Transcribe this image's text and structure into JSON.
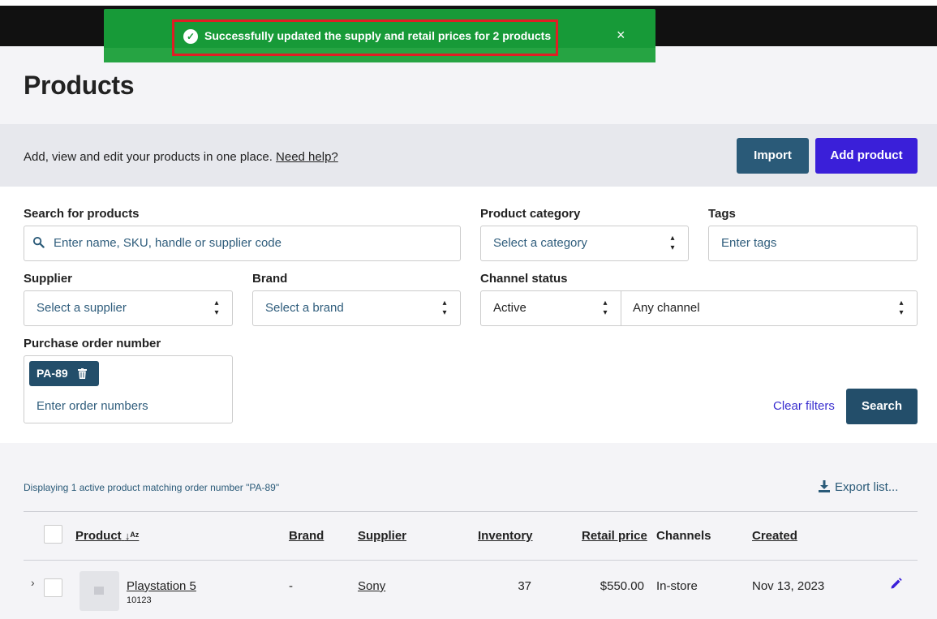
{
  "toast": {
    "message": "Successfully updated the supply and retail prices for 2 products",
    "close_glyph": "×",
    "check_glyph": "✓",
    "color": "#179a38"
  },
  "header": {
    "title": "Products"
  },
  "intro": {
    "text": "Add, view and edit your products in one place. ",
    "help_link": "Need help?",
    "import_label": "Import",
    "add_product_label": "Add product"
  },
  "filters": {
    "search": {
      "label": "Search for products",
      "placeholder": "Enter name, SKU, handle or supplier code",
      "icon": "search-icon"
    },
    "category": {
      "label": "Product category",
      "placeholder": "Select a category"
    },
    "tags": {
      "label": "Tags",
      "placeholder": "Enter tags"
    },
    "supplier": {
      "label": "Supplier",
      "placeholder": "Select a supplier"
    },
    "brand": {
      "label": "Brand",
      "placeholder": "Select a brand"
    },
    "channel_status": {
      "label": "Channel status",
      "status_value": "Active",
      "channel_value": "Any channel"
    },
    "purchase_order": {
      "label": "Purchase order number",
      "chip": "PA-89",
      "placeholder": "Enter order numbers"
    },
    "clear_label": "Clear filters",
    "search_label": "Search"
  },
  "results": {
    "message": "Displaying 1 active product matching order number \"PA-89\"",
    "export_label": "Export list...",
    "columns": {
      "product": "Product",
      "sort_glyph": "↓ᴬᶻ",
      "brand": "Brand",
      "supplier": "Supplier",
      "inventory": "Inventory",
      "retail_price": "Retail price",
      "channels": "Channels",
      "created": "Created"
    },
    "rows": [
      {
        "name": "Playstation 5",
        "sku": "10123",
        "brand": "-",
        "supplier": "Sony",
        "inventory": "37",
        "retail_price": "$550.00",
        "channels": "In-store",
        "created": "Nov 13, 2023"
      }
    ]
  },
  "colors": {
    "primary_dark": "#234e6a",
    "primary_accent": "#3a1fd9",
    "link_accent": "#3a2fcf"
  }
}
